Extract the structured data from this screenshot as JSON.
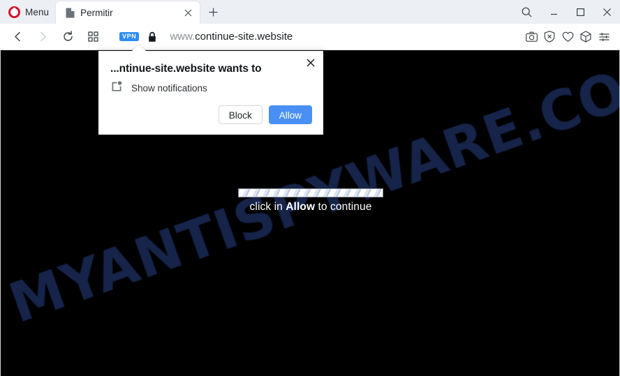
{
  "browser": {
    "name": "Opera",
    "menu_label": "Menu",
    "logo_color": "#d6122b",
    "tab": {
      "title": "Permitir",
      "favicon": "page-icon",
      "close_label": "×"
    },
    "new_tab_label": "+",
    "window_controls": [
      {
        "name": "search-icon",
        "label": ""
      },
      {
        "name": "minimize-button",
        "label": ""
      },
      {
        "name": "maximize-button",
        "label": ""
      },
      {
        "name": "close-window-button",
        "label": ""
      }
    ]
  },
  "toolbar": {
    "back_icon": "back-arrow-icon",
    "forward_icon": "forward-arrow-icon",
    "reload_icon": "reload-icon",
    "speed_dial_icon": "grid-icon",
    "vpn_badge": "VPN",
    "vpn_badge_color": "#2d8cf7",
    "lock_icon": "padlock-icon",
    "url_scheme": "www.",
    "url_domain": "continue-site.website",
    "url_full": "www.continue-site.website",
    "right_icons": [
      {
        "name": "snapshot-camera-icon"
      },
      {
        "name": "ad-blocker-shield-icon"
      },
      {
        "name": "heart-icon"
      },
      {
        "name": "cube-icon"
      },
      {
        "name": "easy-setup-sliders-icon"
      }
    ]
  },
  "permission_dialog": {
    "title": "...ntinue-site.website wants to",
    "permission_icon": "notification-bell-icon",
    "permission_label": "Show notifications",
    "block_label": "Block",
    "allow_label": "Allow",
    "close_label": "✕",
    "allow_color": "#4a90f4"
  },
  "page": {
    "background_color": "#000000",
    "watermark": "MYANTISPYWARE.COM",
    "watermark_color": "#16244a",
    "progress_bar": {
      "name": "loading-progress-bar",
      "style": "striped-marquee"
    },
    "instruction_prefix": "click in ",
    "instruction_emphasis": "Allow",
    "instruction_suffix": " to continue"
  }
}
